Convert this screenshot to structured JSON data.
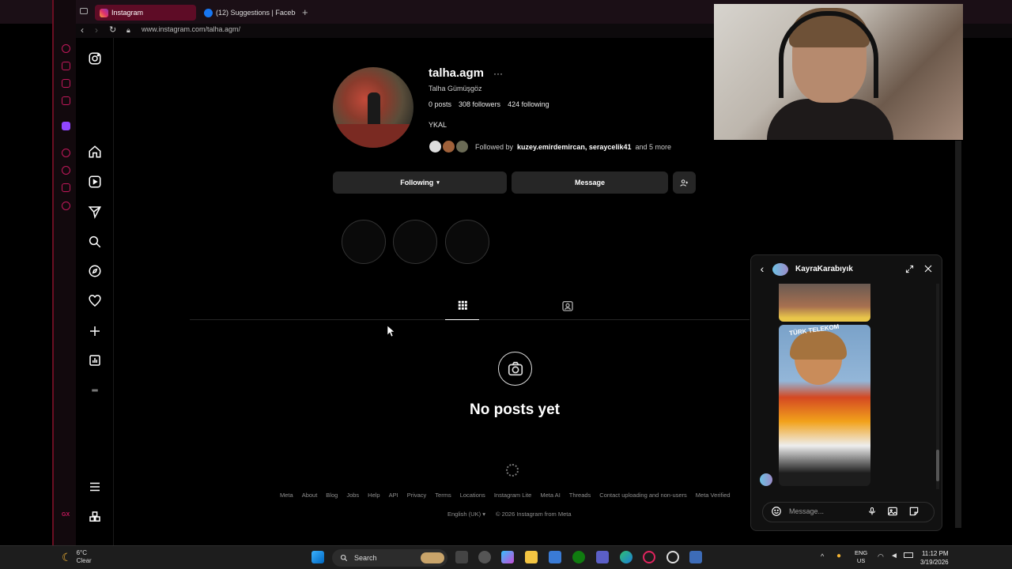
{
  "browser": {
    "tabs": [
      {
        "label": "Instagram",
        "active": true
      },
      {
        "label": "(12) Suggestions | Facebo",
        "active": false
      }
    ],
    "url": "www.instagram.com/talha.agm/"
  },
  "profile": {
    "username": "talha.agm",
    "more": "···",
    "full_name": "Talha Gümüşgöz",
    "posts": "0 posts",
    "followers": "308 followers",
    "following": "424 following",
    "bio": "YKAL",
    "followed_prefix": "Followed by",
    "followed_names": "kuzey.emirdemircan, seraycelik41",
    "followed_suffix": "and 5 more",
    "following_button": "Following",
    "message_button": "Message",
    "empty_title": "No posts yet"
  },
  "footer": {
    "links": [
      "Meta",
      "About",
      "Blog",
      "Jobs",
      "Help",
      "API",
      "Privacy",
      "Terms",
      "Locations",
      "Instagram Lite",
      "Meta AI",
      "Threads",
      "Contact uploading and non-users",
      "Meta Verified"
    ],
    "language": "English (UK)",
    "copyright": "© 2026 Instagram from Meta"
  },
  "chat": {
    "contact": "KayraKarabıyık",
    "image_text": "TÜRK TELEKOM",
    "input_placeholder": "Message..."
  },
  "taskbar": {
    "temperature": "6°C",
    "condition": "Clear",
    "search": "Search",
    "lang_top": "ENG",
    "lang_bottom": "US",
    "time": "11:12 PM",
    "date": "3/19/2026"
  },
  "colors": {
    "accent": "#c2185b",
    "active_tab": "#5e0c26",
    "button_bg": "#262626"
  }
}
